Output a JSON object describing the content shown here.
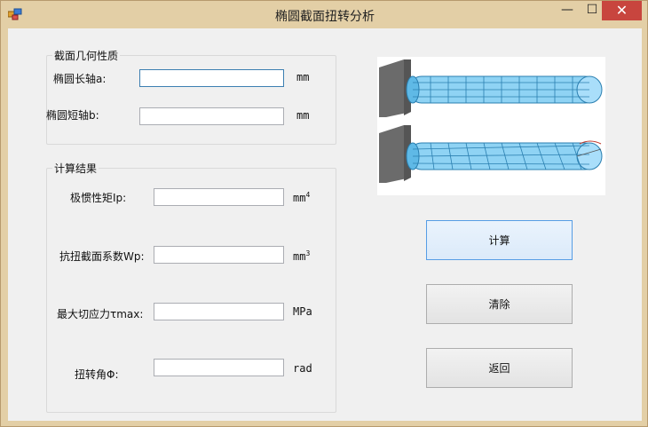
{
  "window": {
    "title": "椭圆截面扭转分析",
    "close_glyph": "✕",
    "min_glyph": "—",
    "max_glyph": "☐"
  },
  "geometry_group": {
    "legend": "截面几何性质",
    "a_label": "椭圆长轴a:",
    "a_value": "",
    "a_unit": "mm",
    "b_label": "椭圆短轴b:",
    "b_value": "",
    "b_unit": "mm"
  },
  "results_group": {
    "legend": "计算结果",
    "ip_label": "极惯性矩Ip:",
    "ip_value": "",
    "ip_unit": "mm",
    "ip_unit_exp": "4",
    "wp_label": "抗扭截面系数Wp:",
    "wp_value": "",
    "wp_unit": "mm",
    "wp_unit_exp": "3",
    "tau_label": "最大切应力τmax:",
    "tau_value": "",
    "tau_unit": "MPa",
    "phi_label": "扭转角Φ:",
    "phi_value": "",
    "phi_unit": "rad"
  },
  "buttons": {
    "calculate": "计算",
    "clear": "清除",
    "back": "返回"
  },
  "colors": {
    "bar_fill": "#8fd3f4",
    "wall": "#6b6b6b",
    "close_bg": "#c8453e"
  }
}
